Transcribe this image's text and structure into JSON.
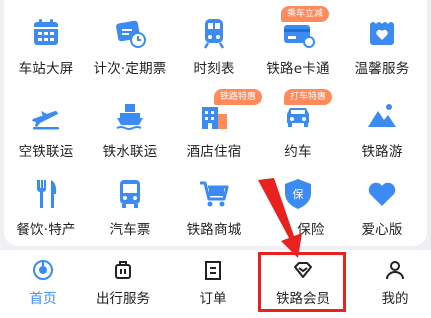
{
  "colors": {
    "icon_blue": "#3b8bf2",
    "badge_orange": "#ff8a5c",
    "highlight_red": "#e8231f",
    "text_dark": "#222222"
  },
  "services": [
    {
      "label": "车站大屏",
      "icon": "calendar-grid-icon"
    },
    {
      "label": "计次·定期票",
      "icon": "ticket-clock-icon"
    },
    {
      "label": "时刻表",
      "icon": "train-front-icon"
    },
    {
      "label": "铁路e卡通",
      "icon": "card-icon",
      "badge": "乘车立减"
    },
    {
      "label": "温馨服务",
      "icon": "heart-box-icon"
    },
    {
      "label": "空铁联运",
      "icon": "airplane-icon"
    },
    {
      "label": "铁水联运",
      "icon": "ship-icon"
    },
    {
      "label": "酒店住宿",
      "icon": "hotel-icon",
      "badge": "铁路特惠"
    },
    {
      "label": "约车",
      "icon": "car-icon",
      "badge": "打车特惠"
    },
    {
      "label": "铁路游",
      "icon": "mountain-icon"
    },
    {
      "label": "餐饮·特产",
      "icon": "fork-knife-icon"
    },
    {
      "label": "汽车票",
      "icon": "bus-icon"
    },
    {
      "label": "铁路商城",
      "icon": "cart-icon"
    },
    {
      "label": "保险",
      "icon": "shield-icon"
    },
    {
      "label": "爱心版",
      "icon": "heart-icon"
    }
  ],
  "tabs": [
    {
      "label": "首页",
      "icon": "home-icon",
      "active": true
    },
    {
      "label": "出行服务",
      "icon": "luggage-icon"
    },
    {
      "label": "订单",
      "icon": "order-list-icon"
    },
    {
      "label": "铁路会员",
      "icon": "diamond-icon"
    },
    {
      "label": "我的",
      "icon": "person-icon"
    }
  ]
}
